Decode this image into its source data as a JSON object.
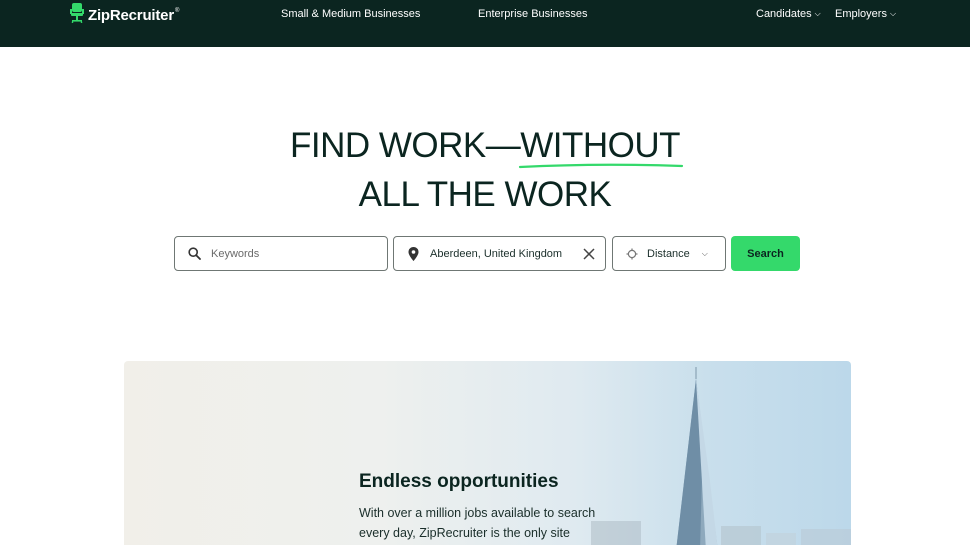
{
  "header": {
    "logo_text": "ZipRecruiter",
    "logo_mark": "®",
    "nav": [
      {
        "label": "Small & Medium Businesses"
      },
      {
        "label": "Enterprise Businesses"
      },
      {
        "label": "Candidates"
      },
      {
        "label": "Employers"
      }
    ]
  },
  "hero": {
    "line1_pre": "FIND WORK—",
    "line1_emph": "WITHOUT",
    "line2": "ALL THE WORK"
  },
  "search": {
    "keywords_placeholder": "Keywords",
    "location_value": "Aberdeen, United Kingdom",
    "distance_label": "Distance",
    "submit_label": "Search"
  },
  "promo": {
    "title": "Endless opportunities",
    "body": "With over a million jobs available to search every day, ZipRecruiter is the only site you'll"
  },
  "colors": {
    "header_bg": "#0b2520",
    "accent_green": "#34d96b",
    "text_dark": "#0b2520"
  },
  "icons": {
    "logo": "office-chair-icon",
    "keywords": "search-icon",
    "location": "map-pin-icon",
    "clear": "close-icon",
    "distance": "crosshair-icon",
    "dropdown": "chevron-down-icon"
  }
}
